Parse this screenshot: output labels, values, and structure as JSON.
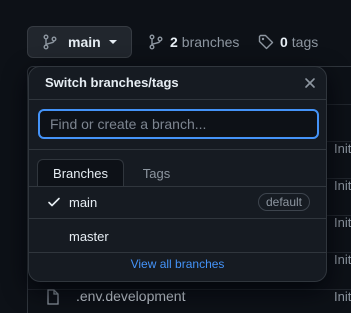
{
  "toolbar": {
    "branch_name": "main",
    "branches_count": "2",
    "branches_label": "branches",
    "tags_count": "0",
    "tags_label": "tags"
  },
  "dropdown": {
    "title": "Switch branches/tags",
    "search_placeholder": "Find or create a branch...",
    "tabs": [
      {
        "label": "Branches",
        "active": true
      },
      {
        "label": "Tags",
        "active": false
      }
    ],
    "branches": [
      {
        "name": "main",
        "selected": true,
        "badge": "default"
      },
      {
        "name": "master",
        "selected": false,
        "badge": ""
      }
    ],
    "view_all_label": "View all branches"
  },
  "files": {
    "commit_msgs": [
      "Init",
      "Init",
      "Init",
      "Init",
      "Init",
      "Init"
    ],
    "visible_file": ".env.development"
  },
  "colors": {
    "accent": "#4493f8",
    "background": "#0d1117",
    "panel": "#161b22"
  }
}
